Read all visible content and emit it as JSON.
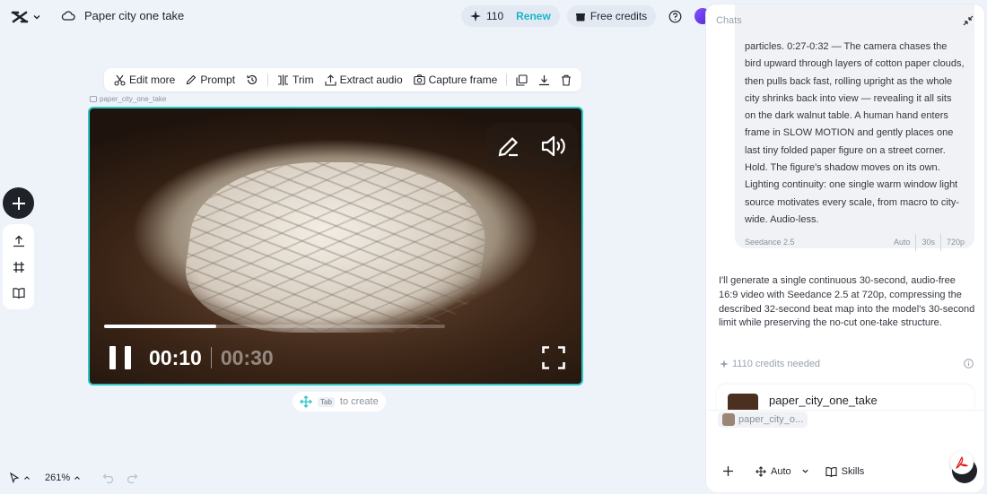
{
  "header": {
    "project_title": "Paper city one take",
    "credits_count": "110",
    "renew_label": "Renew",
    "free_credits_label": "Free credits"
  },
  "toolbar": {
    "edit_more": "Edit more",
    "prompt": "Prompt",
    "trim": "Trim",
    "extract_audio": "Extract audio",
    "capture_frame": "Capture frame"
  },
  "canvas": {
    "file_label": "paper_city_one_take",
    "tab_key": "Tab",
    "tab_hint": "to create",
    "zoom": "261%"
  },
  "player": {
    "current_time": "00:10",
    "total_time": "00:30",
    "progress": 0.33
  },
  "chat": {
    "title": "Chats",
    "user_message": "particles. 0:27-0:32 — The camera chases the bird upward through layers of cotton paper clouds, then pulls back fast, rolling upright as the whole city shrinks back into view — revealing it all sits on the dark walnut table. A human hand enters frame in SLOW MOTION and gently places one last tiny folded paper figure on a street corner. Hold. The figure's shadow moves on its own. Lighting continuity: one single warm window light source motivates every scale, from macro to city-wide. Audio-less.",
    "model": "Seedance 2.5",
    "meta_ratio": "Auto",
    "meta_duration": "30s",
    "meta_resolution": "720p",
    "bot_message": "I'll generate a single continuous 30-second, audio-free 16:9 video with Seedance 2.5 at 720p, compressing the described 32-second beat map into the model's 30-second limit while preserving the no-cut one-take structure.",
    "credits_needed": "1110 credits needed",
    "card_title": "paper_city_one_take",
    "attachment": "paper_city_o...",
    "footer_auto": "Auto",
    "footer_skills": "Skills"
  },
  "colors": {
    "accent": "#2ec4c4",
    "renew": "#1bb5c8",
    "dark": "#1f2329"
  }
}
